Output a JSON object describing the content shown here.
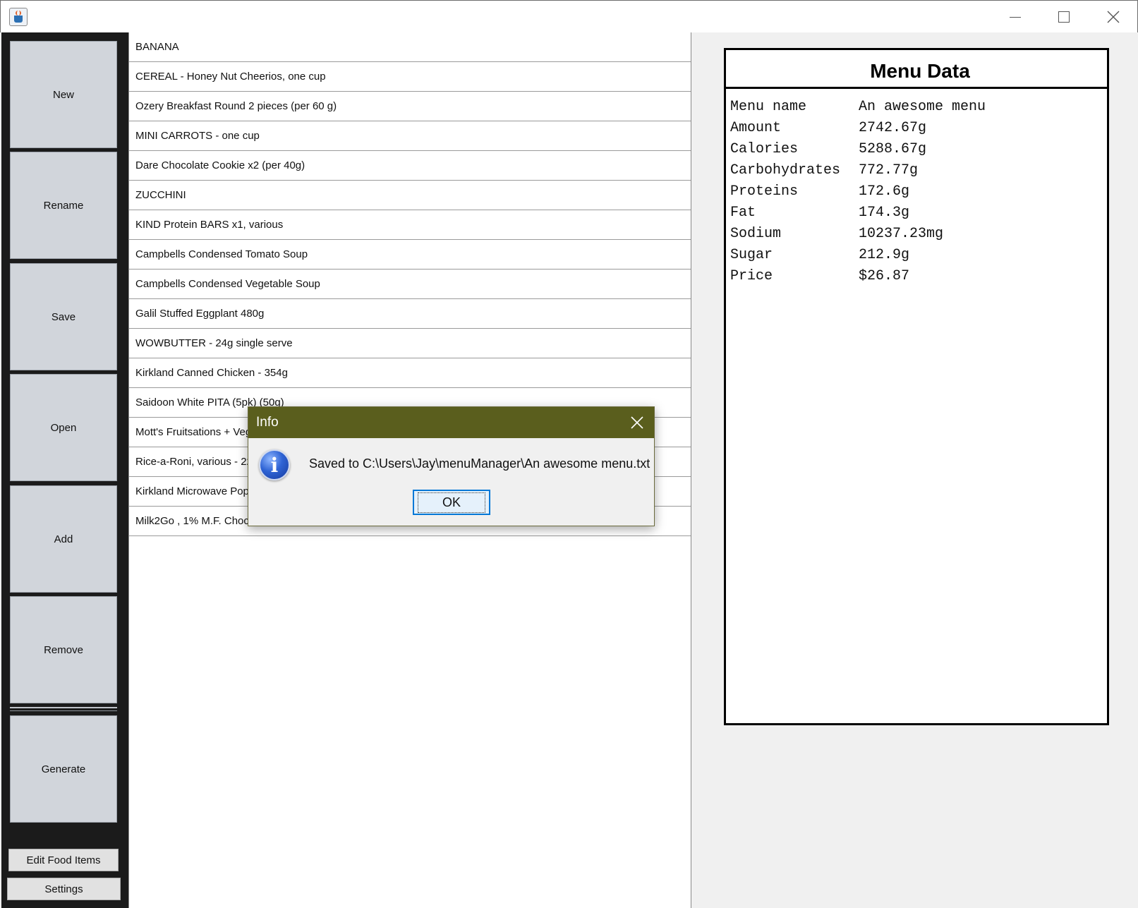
{
  "toolbar": {
    "new_label": "New",
    "rename_label": "Rename",
    "save_label": "Save",
    "open_label": "Open",
    "add_label": "Add",
    "remove_label": "Remove",
    "generate_label": "Generate",
    "edit_food_label": "Edit Food Items",
    "settings_label": "Settings"
  },
  "food_list": [
    "BANANA",
    "CEREAL - Honey Nut Cheerios, one cup",
    "Ozery Breakfast Round 2 pieces (per 60 g)",
    "MINI CARROTS - one cup",
    "Dare Chocolate Cookie x2 (per 40g)",
    "ZUCCHINI",
    "KIND Protein BARS x1, various",
    "Campbells Condensed Tomato Soup",
    "Campbells Condensed Vegetable Soup",
    "Galil Stuffed Eggplant 480g",
    "WOWBUTTER - 24g single serve",
    "Kirkland Canned Chicken - 354g",
    "Saidoon White PITA (5pk) (50g)",
    "Mott's Fruitsations + Veg",
    "Rice-a-Roni, various - 22",
    "Kirkland Microwave Popc",
    "Milk2Go , 1% M.F. Choc"
  ],
  "menu_data": {
    "title": "Menu Data",
    "rows": [
      {
        "label": "Menu name",
        "value": "An awesome menu"
      },
      {
        "label": "Amount",
        "value": "2742.67g"
      },
      {
        "label": "Calories",
        "value": "5288.67g"
      },
      {
        "label": "Carbohydrates",
        "value": "772.77g"
      },
      {
        "label": "Proteins",
        "value": "172.6g"
      },
      {
        "label": "Fat",
        "value": "174.3g"
      },
      {
        "label": "Sodium",
        "value": "10237.23mg"
      },
      {
        "label": "Sugar",
        "value": "212.9g"
      },
      {
        "label": "Price",
        "value": "$26.87"
      }
    ]
  },
  "dialog": {
    "title": "Info",
    "message": "Saved to C:\\Users\\Jay\\menuManager\\An awesome menu.txt",
    "ok_label": "OK",
    "icon": "info-icon"
  },
  "colors": {
    "sidebar_bg": "#1b1b1b",
    "button_bg": "#d1d5db",
    "dialog_title_bg": "#5a5e1d",
    "ok_border": "#0078d7"
  }
}
